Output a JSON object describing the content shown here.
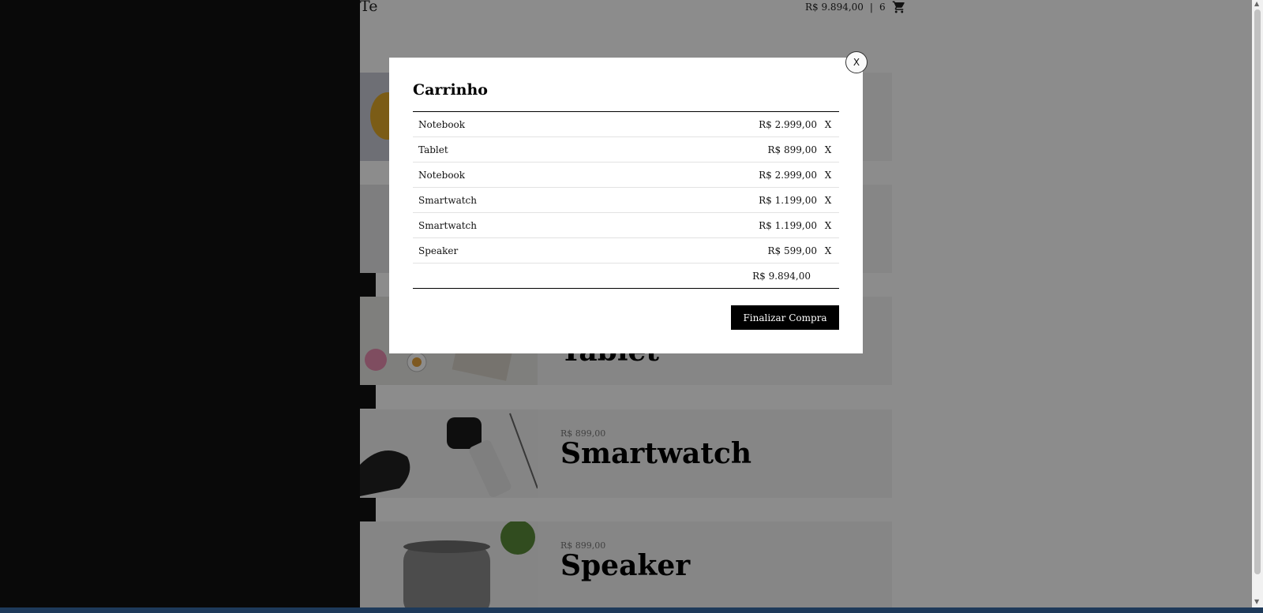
{
  "header": {
    "brand": "Te",
    "cart_total": "R$ 9.894,00",
    "separator": "|",
    "cart_count": "6",
    "cart_icon": "shopping-cart-icon"
  },
  "products": [
    {
      "name": "Tablet",
      "price": ""
    },
    {
      "name": "Smartwatch",
      "price": "R$ 899,00"
    },
    {
      "name": "Speaker",
      "price": "R$ 899,00"
    }
  ],
  "modal": {
    "close_label": "X",
    "title": "Carrinho",
    "items": [
      {
        "name": "Notebook",
        "price": "R$ 2.999,00",
        "remove": "X"
      },
      {
        "name": "Tablet",
        "price": "R$ 899,00",
        "remove": "X"
      },
      {
        "name": "Notebook",
        "price": "R$ 2.999,00",
        "remove": "X"
      },
      {
        "name": "Smartwatch",
        "price": "R$ 1.199,00",
        "remove": "X"
      },
      {
        "name": "Smartwatch",
        "price": "R$ 1.199,00",
        "remove": "X"
      },
      {
        "name": "Speaker",
        "price": "R$ 599,00",
        "remove": "X"
      }
    ],
    "total": "R$ 9.894,00",
    "checkout_label": "Finalizar Compra"
  },
  "colors": {
    "overlay": "rgba(0,0,0,0.45)",
    "button": "#000000",
    "dark_panel": "#111111"
  }
}
